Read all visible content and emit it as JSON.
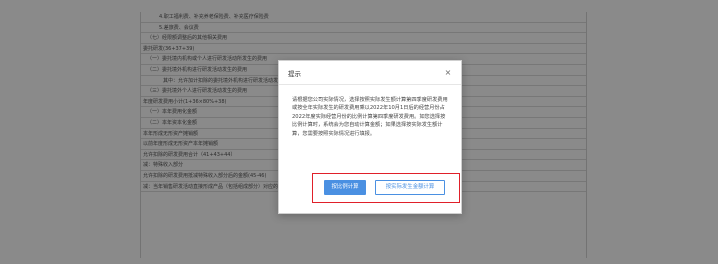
{
  "background_form": {
    "rows": [
      "4.职工福利费、补充养老保险费、补充医疗保险费",
      "5.差旅费、会议费",
      "（七）经限额调整后的其他相关费用",
      "委托研发(36+37+39)",
      "（一）委托境内机构或个人进行研发活动所发生的费用",
      "（二）委托境外机构进行研发活动发生的费用",
      "其中：允许加计扣除的委托境外机构进行研发活动发生的费用",
      "（三）委托境外个人进行研发活动发生的费用",
      "年度研发费用小计(1+36×80%+38)",
      "（一）本年费用化金额",
      "（二）本年资本化金额",
      "本年形成无形资产摊销额",
      "以前年度形成无形资产本年摊销额",
      "允许扣除的研发费用合计（41+43+44）",
      "减：特殊收入部分",
      "允许扣除的研发费用抵减特殊收入部分后的金额(45-46)",
      "减：当年销售研发活动直接形成产品（包括组成部分）对应的材料部分"
    ]
  },
  "dialog": {
    "title": "提示",
    "close_label": "×",
    "message": "请根据您公司实际情况，选择按照实际发生额计算第四季度研发费用或按全年实际发生的研发费用乘以2022年10月1日后的经营月份占2022年度实际经营月份的比例计算第四季度研发费用。如您选择按比例计算时，系统会为您自动计算金额；如果选择按实际发生额计算，您需要按照实际情况进行填报。",
    "primary_button": "按比例计算",
    "secondary_button": "按实际发生金额计算"
  },
  "colors": {
    "accent": "#4a90e2",
    "highlight": "#e0202a"
  }
}
